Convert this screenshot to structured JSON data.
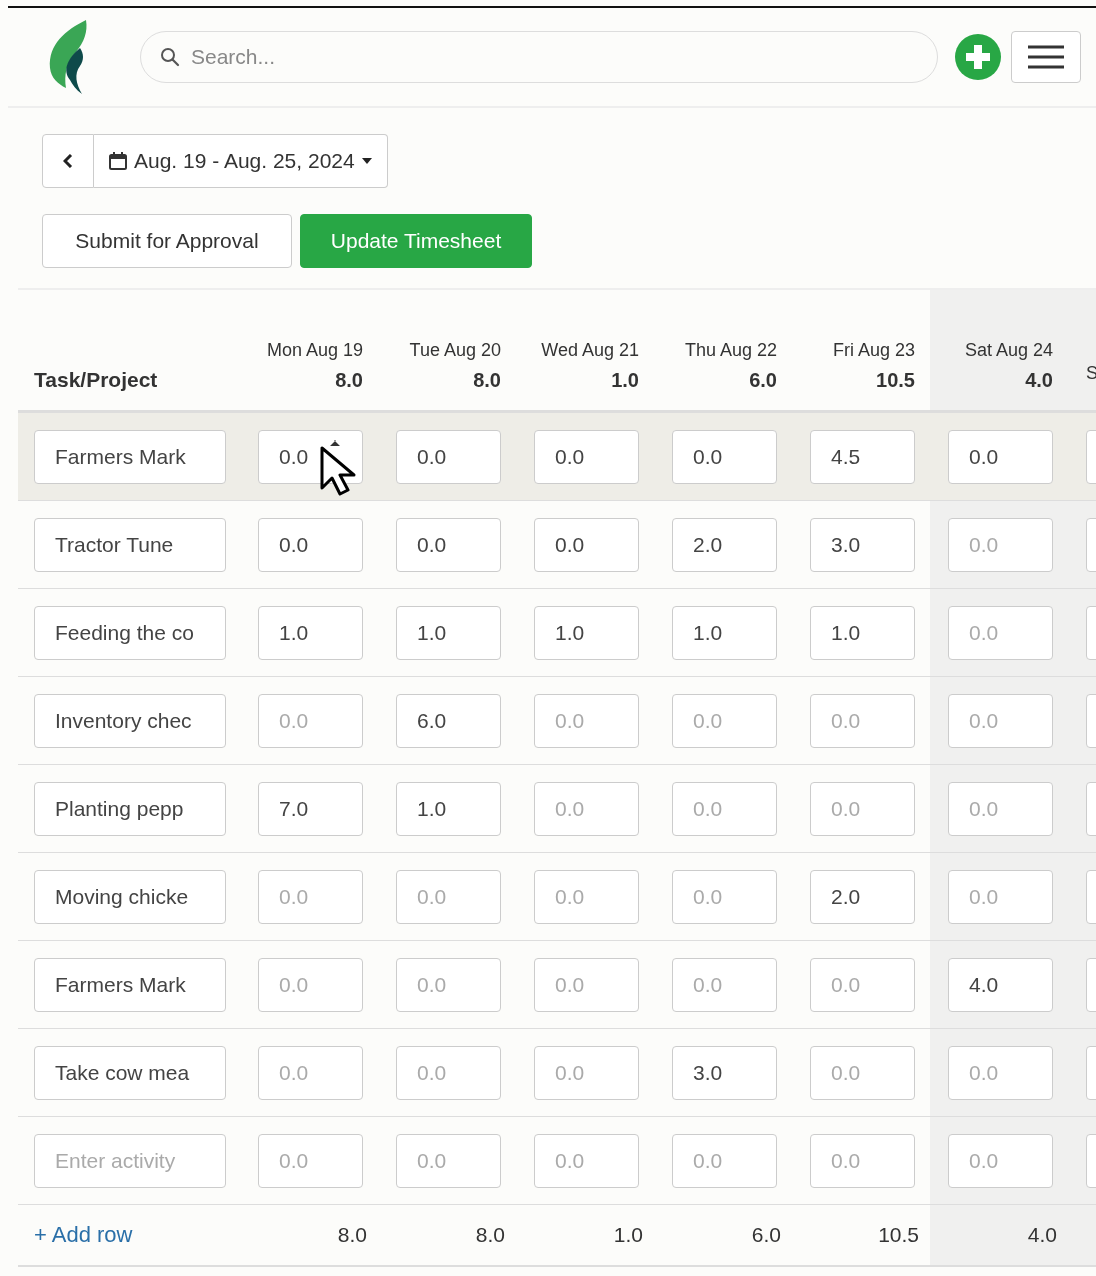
{
  "search": {
    "placeholder": "Search..."
  },
  "date_range": {
    "label": "Aug. 19 - Aug. 25, 2024"
  },
  "buttons": [
    {
      "label": "Submit for Approval",
      "kind": "secondary"
    },
    {
      "label": "Update Timesheet",
      "kind": "primary"
    }
  ],
  "table": {
    "task_heading": "Task/Project",
    "columns": [
      {
        "label": "Mon Aug 19",
        "total": "8.0",
        "weekend": false
      },
      {
        "label": "Tue Aug 20",
        "total": "8.0",
        "weekend": false
      },
      {
        "label": "Wed Aug 21",
        "total": "1.0",
        "weekend": false
      },
      {
        "label": "Thu Aug 22",
        "total": "6.0",
        "weekend": false
      },
      {
        "label": "Fri Aug 23",
        "total": "10.5",
        "weekend": false
      },
      {
        "label": "Sat Aug 24",
        "total": "4.0",
        "weekend": true
      },
      {
        "label": "S",
        "weekend": true
      }
    ],
    "rows": [
      {
        "task": {
          "value": "Farmers Mark"
        },
        "highlighted": true,
        "cells": [
          {
            "value": "0.0"
          },
          {
            "value": "0.0"
          },
          {
            "value": "0.0"
          },
          {
            "value": "0.0"
          },
          {
            "value": "4.5"
          },
          {
            "value": "0.0"
          }
        ]
      },
      {
        "task": {
          "value": "Tractor Tune"
        },
        "highlighted": false,
        "cells": [
          {
            "value": "0.0"
          },
          {
            "value": "0.0"
          },
          {
            "value": "0.0"
          },
          {
            "value": "2.0"
          },
          {
            "value": "3.0"
          },
          {
            "placeholder": "0.0"
          }
        ]
      },
      {
        "task": {
          "value": "Feeding the co"
        },
        "highlighted": false,
        "cells": [
          {
            "value": "1.0"
          },
          {
            "value": "1.0"
          },
          {
            "value": "1.0"
          },
          {
            "value": "1.0"
          },
          {
            "value": "1.0"
          },
          {
            "placeholder": "0.0"
          }
        ]
      },
      {
        "task": {
          "value": "Inventory chec"
        },
        "highlighted": false,
        "cells": [
          {
            "placeholder": "0.0"
          },
          {
            "value": "6.0"
          },
          {
            "placeholder": "0.0"
          },
          {
            "placeholder": "0.0"
          },
          {
            "placeholder": "0.0"
          },
          {
            "placeholder": "0.0"
          }
        ]
      },
      {
        "task": {
          "value": "Planting pepp"
        },
        "highlighted": false,
        "cells": [
          {
            "value": "7.0"
          },
          {
            "value": "1.0"
          },
          {
            "placeholder": "0.0"
          },
          {
            "placeholder": "0.0"
          },
          {
            "placeholder": "0.0"
          },
          {
            "placeholder": "0.0"
          }
        ]
      },
      {
        "task": {
          "value": "Moving chicke"
        },
        "highlighted": false,
        "cells": [
          {
            "placeholder": "0.0"
          },
          {
            "placeholder": "0.0"
          },
          {
            "placeholder": "0.0"
          },
          {
            "placeholder": "0.0"
          },
          {
            "value": "2.0"
          },
          {
            "placeholder": "0.0"
          }
        ]
      },
      {
        "task": {
          "value": "Farmers Mark"
        },
        "highlighted": false,
        "cells": [
          {
            "placeholder": "0.0"
          },
          {
            "placeholder": "0.0"
          },
          {
            "placeholder": "0.0"
          },
          {
            "placeholder": "0.0"
          },
          {
            "placeholder": "0.0"
          },
          {
            "value": "4.0"
          }
        ]
      },
      {
        "task": {
          "value": "Take cow mea"
        },
        "highlighted": false,
        "cells": [
          {
            "placeholder": "0.0"
          },
          {
            "placeholder": "0.0"
          },
          {
            "placeholder": "0.0"
          },
          {
            "value": "3.0"
          },
          {
            "placeholder": "0.0"
          },
          {
            "placeholder": "0.0"
          }
        ]
      },
      {
        "task": {
          "placeholder": "Enter activity"
        },
        "highlighted": false,
        "cells": [
          {
            "placeholder": "0.0"
          },
          {
            "placeholder": "0.0"
          },
          {
            "placeholder": "0.0"
          },
          {
            "placeholder": "0.0"
          },
          {
            "placeholder": "0.0"
          },
          {
            "placeholder": "0.0"
          }
        ]
      }
    ],
    "footer": {
      "add_row": "+ Add row",
      "totals": [
        "8.0",
        "8.0",
        "1.0",
        "6.0",
        "10.5",
        "4.0"
      ]
    }
  }
}
